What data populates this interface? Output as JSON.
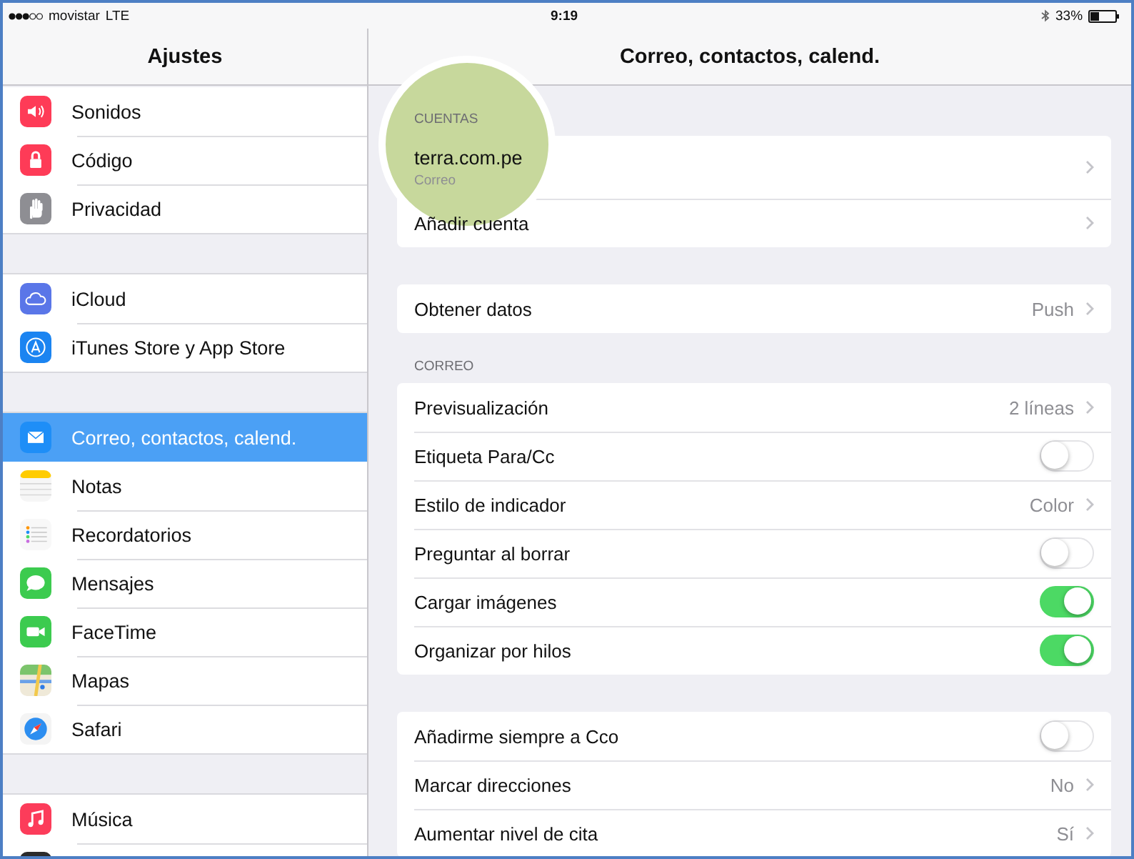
{
  "status_bar": {
    "carrier": "movistar",
    "network": "LTE",
    "time": "9:19",
    "battery": "33%"
  },
  "sidebar": {
    "title": "Ajustes",
    "groups": [
      {
        "items": [
          {
            "label": "Sonidos",
            "selected": false
          },
          {
            "label": "Código",
            "selected": false
          },
          {
            "label": "Privacidad",
            "selected": false
          }
        ]
      },
      {
        "items": [
          {
            "label": "iCloud",
            "selected": false
          },
          {
            "label": "iTunes Store y App Store",
            "selected": false
          }
        ]
      },
      {
        "items": [
          {
            "label": "Correo, contactos, calend.",
            "selected": true
          },
          {
            "label": "Notas",
            "selected": false
          },
          {
            "label": "Recordatorios",
            "selected": false
          },
          {
            "label": "Mensajes",
            "selected": false
          },
          {
            "label": "FaceTime",
            "selected": false
          },
          {
            "label": "Mapas",
            "selected": false
          },
          {
            "label": "Safari",
            "selected": false
          }
        ]
      },
      {
        "items": [
          {
            "label": "Música",
            "selected": false
          },
          {
            "selected": false
          }
        ]
      }
    ]
  },
  "detail": {
    "title": "Correo, contactos, calend.",
    "sections": [
      {
        "header": "CUENTAS",
        "rows": [
          {
            "kind": "account",
            "label": "terra.com.pe",
            "subtitle": "Correo"
          },
          {
            "kind": "link",
            "label": "Añadir cuenta"
          }
        ]
      },
      {
        "rows": [
          {
            "kind": "disclosure",
            "label": "Obtener datos",
            "value": "Push"
          }
        ]
      },
      {
        "header": "CORREO",
        "rows": [
          {
            "kind": "disclosure",
            "label": "Previsualización",
            "value": "2 líneas"
          },
          {
            "kind": "toggle",
            "label": "Etiqueta Para/Cc",
            "on": false
          },
          {
            "kind": "disclosure",
            "label": "Estilo de indicador",
            "value": "Color"
          },
          {
            "kind": "toggle",
            "label": "Preguntar al borrar",
            "on": false
          },
          {
            "kind": "toggle",
            "label": "Cargar imágenes",
            "on": true
          },
          {
            "kind": "toggle",
            "label": "Organizar por hilos",
            "on": true
          }
        ]
      },
      {
        "rows": [
          {
            "kind": "toggle",
            "label": "Añadirme siempre a Cco",
            "on": false
          },
          {
            "kind": "disclosure",
            "label": "Marcar direcciones",
            "value": "No"
          },
          {
            "kind": "disclosure",
            "label": "Aumentar nivel de cita",
            "value": "Sí"
          }
        ]
      }
    ]
  }
}
